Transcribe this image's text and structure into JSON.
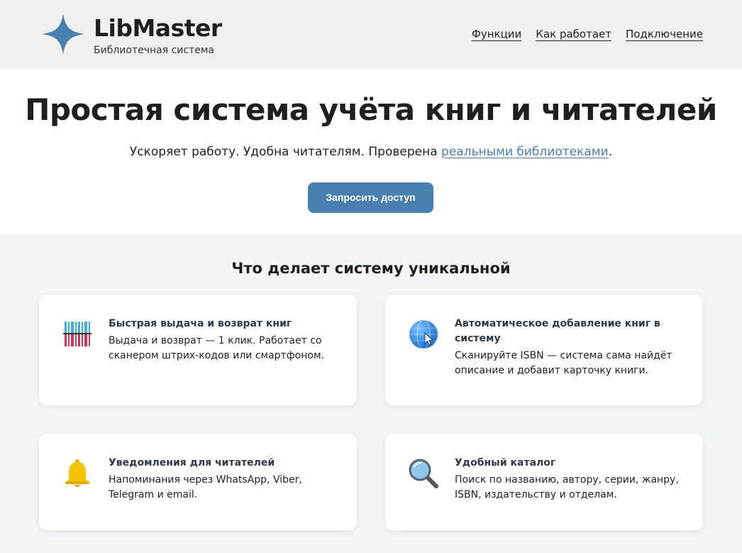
{
  "header": {
    "brand": "LibMaster",
    "tagline": "Библиотечная система",
    "logo_icon": "four-point-star-icon",
    "nav": [
      "Функции",
      "Как работает",
      "Подключение"
    ]
  },
  "hero": {
    "title": "Простая система учёта книг и читателей",
    "subtitle_prefix": "Ускоряет работу. Удобна читателям. Проверена ",
    "subtitle_link": "реальными библиотеками",
    "subtitle_suffix": ".",
    "cta_label": "Запросить доступ"
  },
  "features": {
    "title": "Что делает систему уникальной",
    "cards": [
      {
        "icon": "barcode-icon",
        "title": "Быстрая выдача и возврат книг",
        "description": "Выдача и возврат — 1 клик. Работает со сканером штрих-кодов или смартфоном."
      },
      {
        "icon": "globe-cursor-icon",
        "title": "Автоматическое добавление книг в систему",
        "description": "Сканируйте ISBN — система сама найдёт описание и добавит карточку книги."
      },
      {
        "icon": "bell-icon",
        "title": "Уведомления для читателей",
        "description": "Напоминания через WhatsApp, Viber, Telegram и email."
      },
      {
        "icon": "magnifier-icon",
        "title": "Удобный каталог",
        "description": "Поиск по названию, автору, серии, жанру, ISBN, издательству и отделам."
      }
    ]
  },
  "colors": {
    "accent": "#4a80b0",
    "link": "#4a7db0",
    "header_bg": "#f0f0f0",
    "page_bg": "#f4f5f7"
  }
}
